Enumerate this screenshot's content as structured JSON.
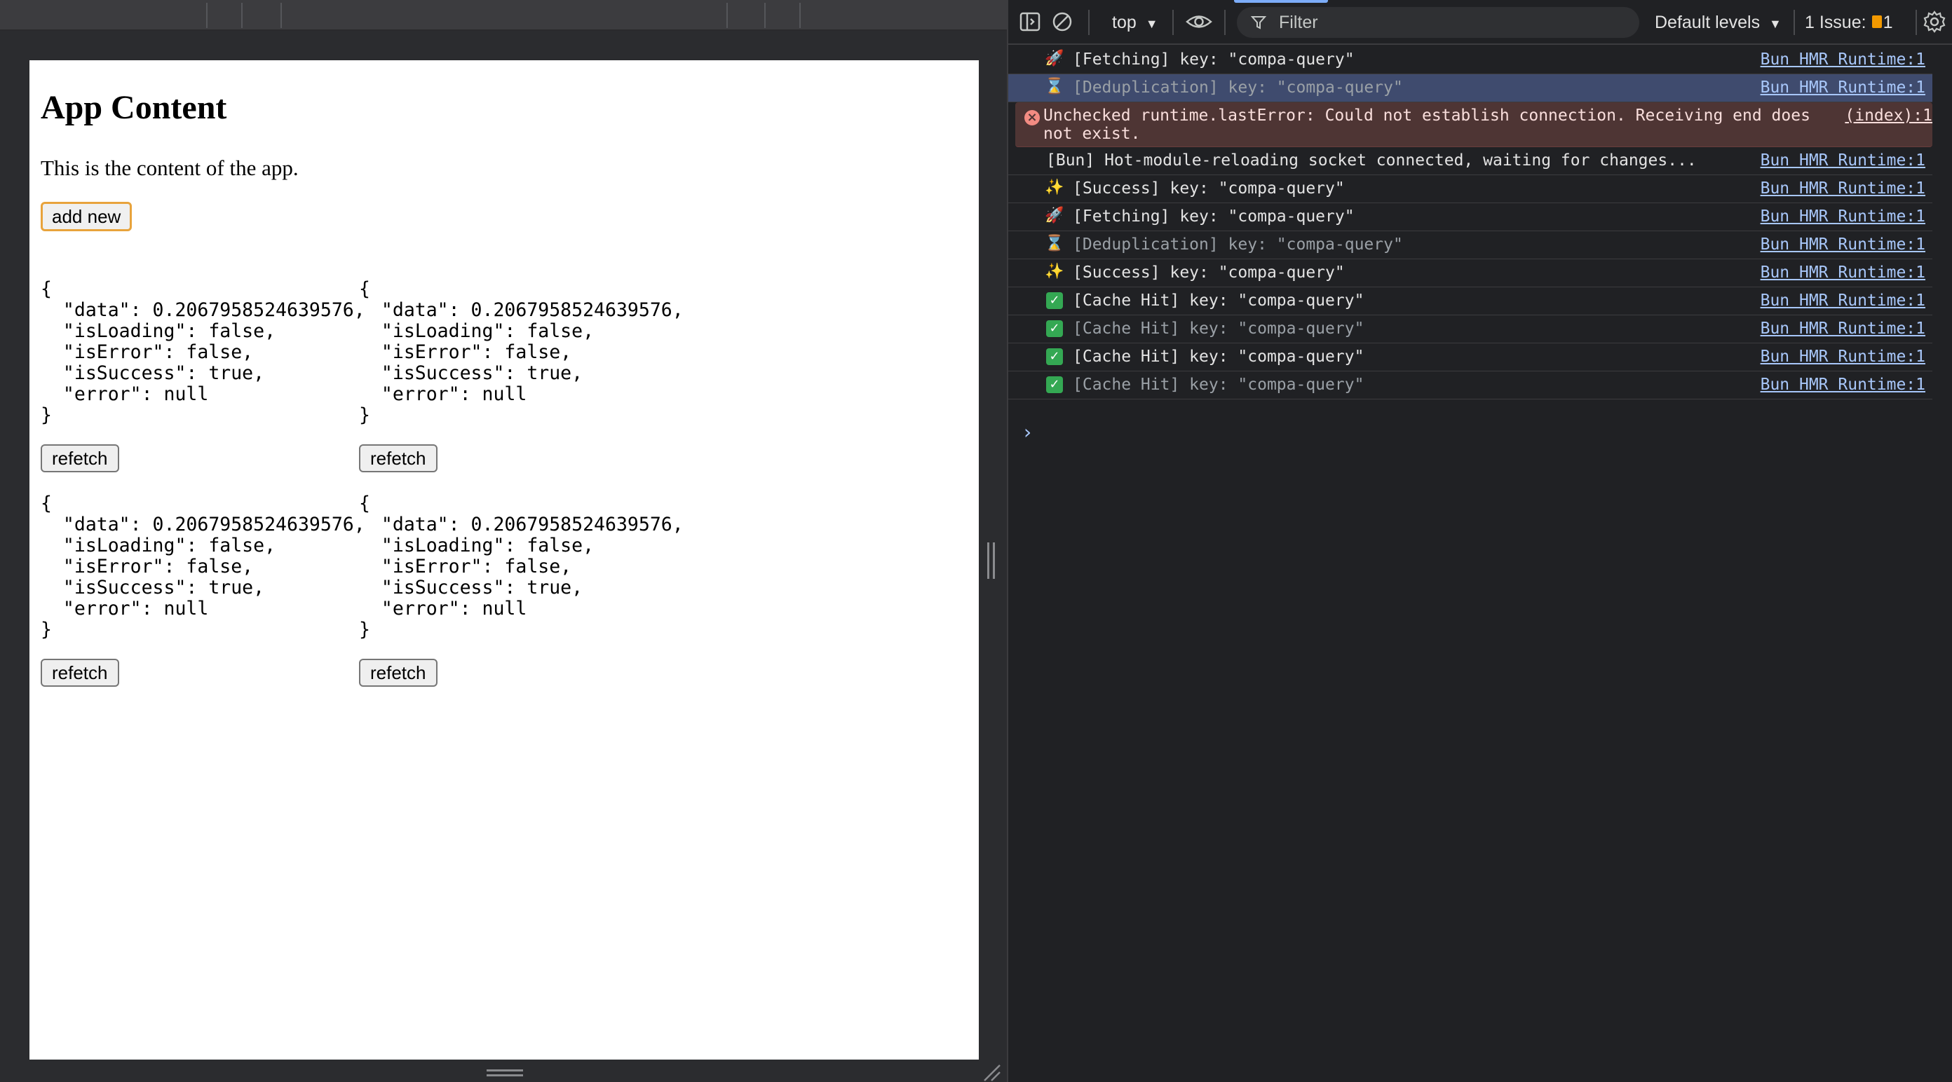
{
  "app": {
    "title": "App Content",
    "description": "This is the content of the app.",
    "add_button": "add new",
    "cards": [
      {
        "json": "{\n  \"data\": 0.2067958524639576,\n  \"isLoading\": false,\n  \"isError\": false,\n  \"isSuccess\": true,\n  \"error\": null\n}",
        "button": "refetch"
      },
      {
        "json": "{\n  \"data\": 0.2067958524639576,\n  \"isLoading\": false,\n  \"isError\": false,\n  \"isSuccess\": true,\n  \"error\": null\n}",
        "button": "refetch"
      },
      {
        "json": "{\n  \"data\": 0.2067958524639576,\n  \"isLoading\": false,\n  \"isError\": false,\n  \"isSuccess\": true,\n  \"error\": null\n}",
        "button": "refetch"
      },
      {
        "json": "{\n  \"data\": 0.2067958524639576,\n  \"isLoading\": false,\n  \"isError\": false,\n  \"isSuccess\": true,\n  \"error\": null\n}",
        "button": "refetch"
      }
    ]
  },
  "toolbar": {
    "context": "top",
    "filter_placeholder": "Filter",
    "levels": "Default levels",
    "issues_label": "1 Issue:",
    "issues_count": "1"
  },
  "log": [
    {
      "icon": "🚀",
      "text": "[Fetching] key: \"compa-query\"",
      "source": "Bun HMR Runtime:1"
    },
    {
      "icon": "⌛",
      "text": "[Deduplication] key: \"compa-query\"",
      "source": "Bun HMR Runtime:1"
    },
    {
      "icon": "error",
      "text": "Unchecked runtime.lastError: Could not establish connection. Receiving end does not exist.",
      "source": "(index):1"
    },
    {
      "icon": "",
      "text": "[Bun] Hot-module-reloading socket connected, waiting for changes...",
      "source": "Bun HMR Runtime:1"
    },
    {
      "icon": "✨",
      "text": "[Success] key: \"compa-query\"",
      "source": "Bun HMR Runtime:1"
    },
    {
      "icon": "🚀",
      "text": "[Fetching] key: \"compa-query\"",
      "source": "Bun HMR Runtime:1"
    },
    {
      "icon": "⌛",
      "text": "[Deduplication] key: \"compa-query\"",
      "source": "Bun HMR Runtime:1"
    },
    {
      "icon": "✨",
      "text": "[Success] key: \"compa-query\"",
      "source": "Bun HMR Runtime:1"
    },
    {
      "icon": "✓",
      "text": "[Cache Hit] key: \"compa-query\"",
      "source": "Bun HMR Runtime:1"
    },
    {
      "icon": "✓",
      "text": "[Cache Hit] key: \"compa-query\"",
      "source": "Bun HMR Runtime:1"
    },
    {
      "icon": "✓",
      "text": "[Cache Hit] key: \"compa-query\"",
      "source": "Bun HMR Runtime:1"
    },
    {
      "icon": "✓",
      "text": "[Cache Hit] key: \"compa-query\"",
      "source": "Bun HMR Runtime:1"
    }
  ],
  "prompt_symbol": "›"
}
